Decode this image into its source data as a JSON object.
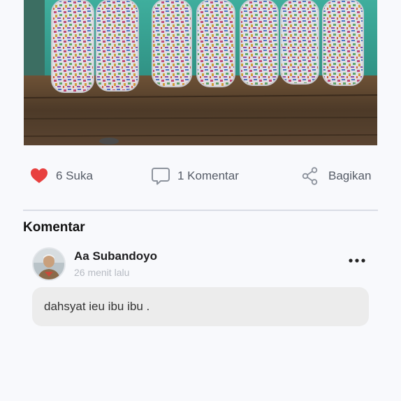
{
  "post": {
    "photo_alt": "bottles-photo"
  },
  "actions": {
    "like_label": "6 Suka",
    "comment_label": "1 Komentar",
    "share_label": "Bagikan",
    "like_color": "#e8403f"
  },
  "comments": {
    "title": "Komentar",
    "items": [
      {
        "author": "Aa Subandoyo",
        "time": "26 menit lalu",
        "text": "dahsyat ieu ibu ibu ."
      }
    ]
  }
}
